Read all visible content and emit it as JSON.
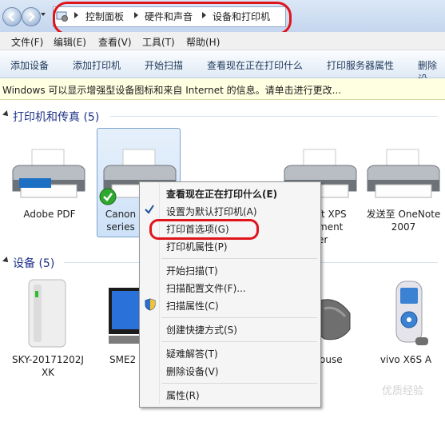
{
  "address_bar": {
    "breadcrumbs": [
      "控制面板",
      "硬件和声音",
      "设备和打印机"
    ]
  },
  "menu": [
    "文件(F)",
    "编辑(E)",
    "查看(V)",
    "工具(T)",
    "帮助(H)"
  ],
  "toolbar": [
    "添加设备",
    "添加打印机",
    "开始扫描",
    "查看现在正在打印什么",
    "打印服务器属性",
    "删除设"
  ],
  "info_bar": "Windows 可以显示增强型设备图标和来自 Internet 的信息。请单击进行更改...",
  "printers_group": {
    "title": "打印机和传真 (5)",
    "items": [
      {
        "line1": "Adobe PDF",
        "line2": ""
      },
      {
        "line1": "Canon",
        "line2": "series"
      },
      {
        "line1": "ft XPS",
        "line2": "ment",
        "line3": "er"
      },
      {
        "line1": "发送至 OneNote",
        "line2": "2007"
      }
    ]
  },
  "devices_group": {
    "title": "设备 (5)",
    "items": [
      {
        "line1": "SKY-20171202J",
        "line2": "XK"
      },
      {
        "line1": "SME2"
      },
      {
        "line1": "ouse"
      },
      {
        "line1": "vivo X6S A"
      }
    ]
  },
  "context_menu": {
    "items": [
      {
        "label": "查看现在正在打印什么(E)",
        "bold": true
      },
      {
        "label": "设置为默认打印机(A)",
        "checked": true
      },
      {
        "label": "打印首选项(G)",
        "highlighted": true
      },
      {
        "label": "打印机属性(P)"
      },
      {
        "label": "开始扫描(T)"
      },
      {
        "label": "扫描配置文件(F)..."
      },
      {
        "label": "扫描属性(C)",
        "shield": true
      },
      {
        "label": "创建快捷方式(S)"
      },
      {
        "label": "疑难解答(T)"
      },
      {
        "label": "删除设备(V)"
      },
      {
        "label": "属性(R)"
      }
    ]
  },
  "watermark": "优质经验"
}
